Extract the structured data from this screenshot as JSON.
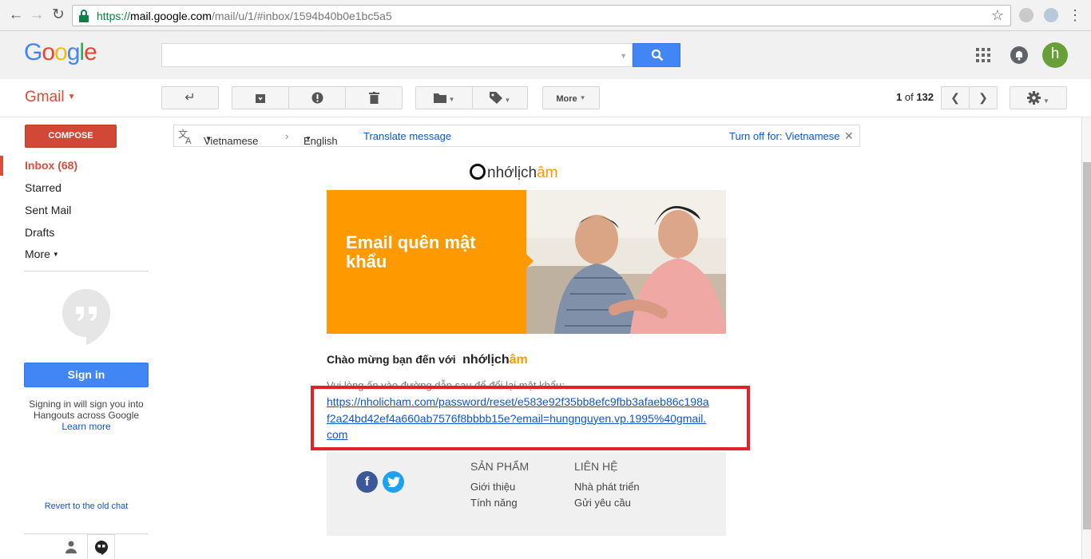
{
  "browser": {
    "url_scheme": "https://",
    "url_host": "mail.google.com",
    "url_path": "/mail/u/1/#inbox/1594b40b0e1bc5a5"
  },
  "header": {
    "logo": [
      "G",
      "o",
      "o",
      "g",
      "l",
      "e"
    ],
    "logo_colors": [
      "#4285f4",
      "#ea4335",
      "#fbbc05",
      "#4285f4",
      "#34a853",
      "#ea4335"
    ],
    "search_value": "",
    "avatar_letter": "h"
  },
  "toolbar": {
    "gmail_label": "Gmail",
    "more_label": "More",
    "page_current": "1",
    "page_of": "of",
    "page_total": "132"
  },
  "sidebar": {
    "compose": "COMPOSE",
    "items": [
      {
        "label": "Inbox (68)",
        "active": true
      },
      {
        "label": "Starred"
      },
      {
        "label": "Sent Mail"
      },
      {
        "label": "Drafts"
      },
      {
        "label": "More"
      }
    ],
    "signin_button": "Sign in",
    "signin_text": "Signing in will sign you into Hangouts across Google",
    "learn_more": "Learn more",
    "revert": "Revert to the old chat"
  },
  "translate": {
    "source_lang": "Vietnamese",
    "target_lang": "English",
    "translate_link": "Translate message",
    "turn_off": "Turn off for: Vietnamese"
  },
  "email": {
    "brand_main": "nhớlịch",
    "brand_accent": "âm",
    "hero_title": "Email quên mật khẩu",
    "welcome": "Chào mừng bạn đến với",
    "instruction": "Vui lòng ấn vào đường dẫn sau để đổi lại mật khẩu:",
    "reset_link": "https://nholicham.com/password/reset/e583e92f35bb8efc9fbb3afaeb86c198af2a24bd42ef4a660ab7576f8bbbb15e?email=hungnguyen.vp.1995%40gmail.com",
    "footer": {
      "col1_title": "SẢN PHẨM",
      "col1_items": [
        "Giới thiệu",
        "Tính năng"
      ],
      "col2_title": "LIÊN HỆ",
      "col2_items": [
        "Nhà phát triển",
        "Gửi yêu cầu"
      ]
    }
  },
  "colors": {
    "gmail_red": "#dd4b39",
    "compose_red": "#d14836",
    "google_blue": "#4285f4",
    "hero_orange": "#ff9900",
    "highlight_red": "#e3212a",
    "link_blue": "#1155cc",
    "facebook_blue": "#3b5998",
    "twitter_blue": "#1da1f2"
  }
}
